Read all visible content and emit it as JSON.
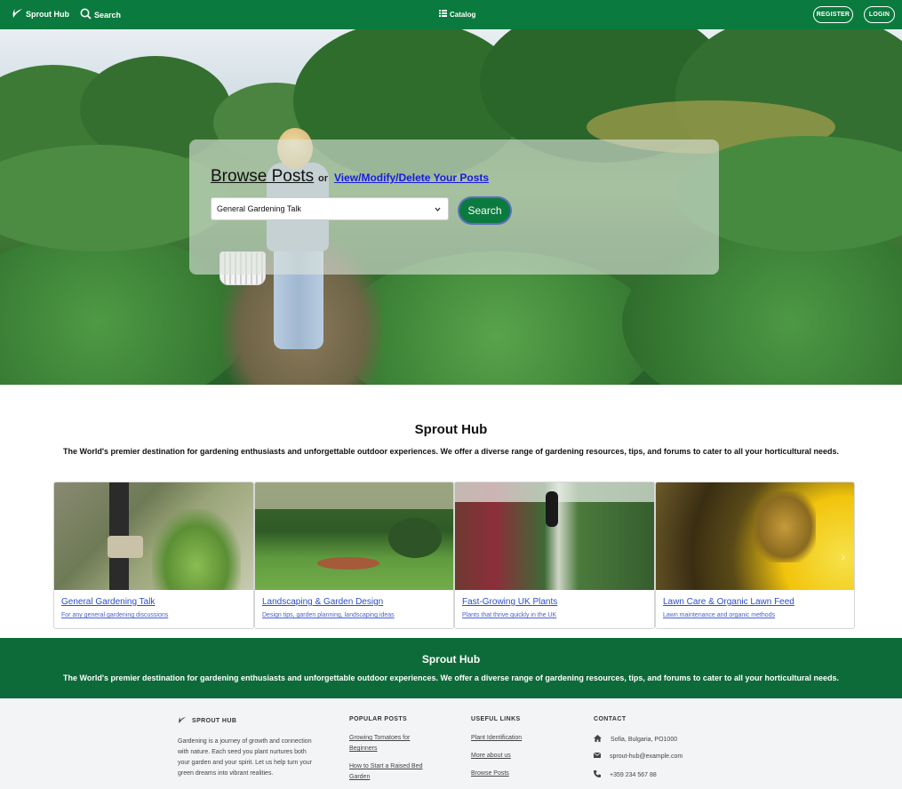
{
  "nav": {
    "brand": "Sprout Hub",
    "search": "Search",
    "catalog": "Catalog",
    "register": "REGISTER",
    "login": "LOGIN"
  },
  "hero": {
    "browse_title": "Browse Posts",
    "or_text": "or",
    "manage_link": "View/Modify/Delete Your Posts",
    "select_value": "General Gardening Talk",
    "search_button": "Search"
  },
  "intro": {
    "title": "Sprout Hub",
    "text": "The World's premier destination for gardening enthusiasts and unforgettable outdoor experiences. We offer a diverse range of gardening resources, tips, and forums to cater to all your horticultural needs."
  },
  "cards": [
    {
      "title": "General Gardening Talk",
      "desc": "For any general gardening discussions"
    },
    {
      "title": "Landscaping & Garden Design",
      "desc": "Design tips, garden planning, landscaping ideas"
    },
    {
      "title": "Fast-Growing UK Plants",
      "desc": "Plants that thrive quickly in the UK"
    },
    {
      "title": "Lawn Care & Organic Lawn Feed",
      "desc": "Lawn maintenance and organic methods"
    }
  ],
  "band": {
    "title": "Sprout Hub",
    "text": "The World's premier destination for gardening enthusiasts and unforgettable outdoor experiences. We offer a diverse range of gardening resources, tips, and forums to cater to all your horticultural needs."
  },
  "footer": {
    "about": {
      "heading": "SPROUT HUB",
      "text": "Gardening is a journey of growth and connection with nature. Each seed you plant nurtures both your garden and your spirit. Let us help turn your green dreams into vibrant realities."
    },
    "popular": {
      "heading": "POPULAR POSTS",
      "links": [
        "Growing Tomatoes for Beginners",
        "How to Start a Raised Bed Garden"
      ]
    },
    "useful": {
      "heading": "USEFUL LINKS",
      "links": [
        "Plant Identification",
        "More about us",
        "Browse Posts"
      ]
    },
    "contact": {
      "heading": "CONTACT",
      "address": "Sofia, Bulgaria, PO1000",
      "email": "sprout-hub@example.com",
      "phone": "+359 234 567 88"
    }
  },
  "colors": {
    "primary_green": "#0b7a3f",
    "band_green": "#0d6b39",
    "link_blue": "#2a4fd0"
  },
  "icons": [
    "sprout-icon",
    "search-icon",
    "list-icon",
    "chevron-down-icon",
    "chevron-right-icon",
    "home-icon",
    "envelope-icon",
    "phone-icon"
  ]
}
